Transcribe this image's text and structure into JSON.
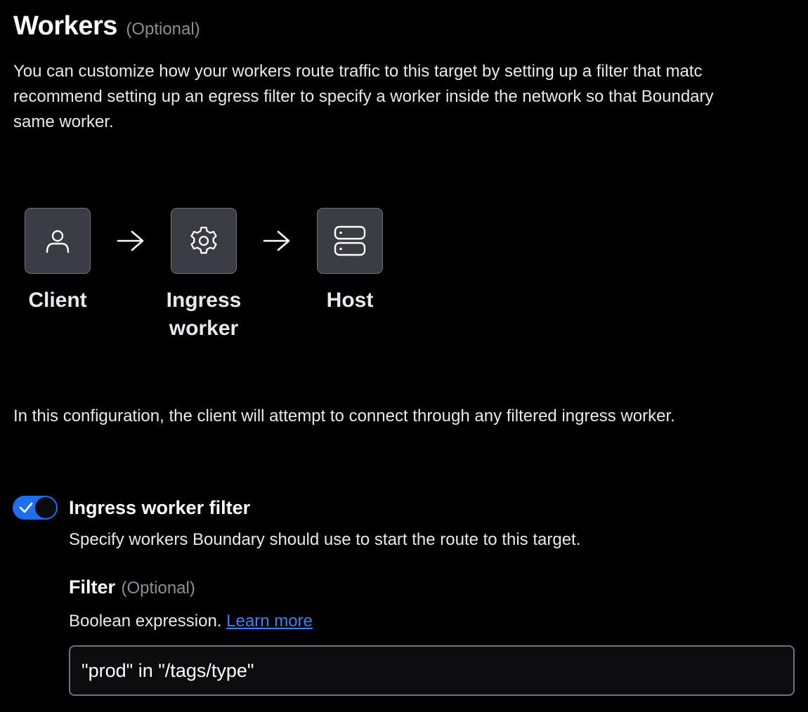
{
  "section": {
    "title": "Workers",
    "optional_label": "(Optional)",
    "description_lines": [
      "You can customize how your workers route traffic to this target by setting up a filter that matc",
      "recommend setting up an egress filter to specify a worker inside the network so that Boundary",
      "same worker."
    ]
  },
  "diagram": {
    "nodes": [
      {
        "label_lines": [
          "Client"
        ],
        "icon": "user-icon"
      },
      {
        "label_lines": [
          "Ingress",
          "worker"
        ],
        "icon": "gear-icon"
      },
      {
        "label_lines": [
          "Host"
        ],
        "icon": "server-icon"
      }
    ],
    "arrow_icon": "arrow-right-icon"
  },
  "configuration_text": "In this configuration, the client will attempt to connect through any filtered ingress worker.",
  "ingress_filter": {
    "toggle_on": true,
    "label": "Ingress worker filter",
    "help": "Specify workers Boundary should use to start the route to this target.",
    "filter_label": "Filter",
    "filter_optional": "(Optional)",
    "filter_help": "Boolean expression.",
    "learn_more": "Learn more",
    "filter_value": "\"prod\" in \"/tags/type\""
  },
  "colors": {
    "background": "#000000",
    "box_fill": "#3a3c43",
    "box_border": "#6f727b",
    "toggle_on": "#1f6ef0",
    "link": "#3b82f6",
    "muted_text": "#8c8f99"
  }
}
